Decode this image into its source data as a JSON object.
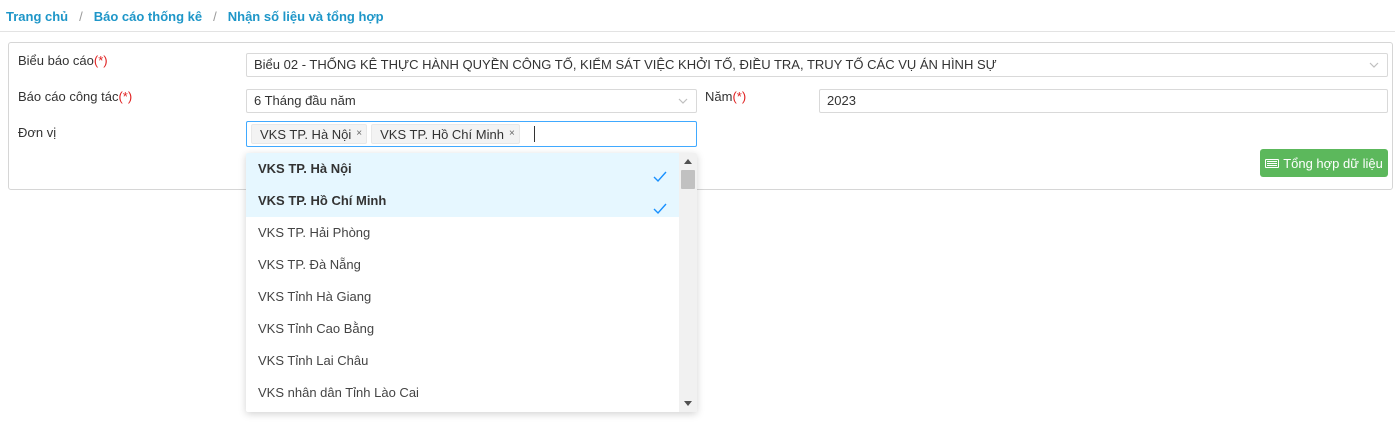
{
  "breadcrumb": {
    "items": [
      "Trang chủ",
      "Báo cáo thống kê",
      "Nhận số liệu và tổng hợp"
    ],
    "separator": "/"
  },
  "form": {
    "report_form": {
      "label": "Biểu báo cáo",
      "required_mark": "(*)",
      "value": "Biểu 02 - THỐNG KÊ THỰC HÀNH QUYỀN CÔNG TỐ, KIỂM SÁT VIỆC KHỞI TỐ, ĐIỀU TRA, TRUY TỐ CÁC VỤ ÁN HÌNH SỰ"
    },
    "work_report": {
      "label": "Báo cáo công tác",
      "required_mark": "(*)",
      "value": "6 Tháng đầu năm"
    },
    "year": {
      "label": "Năm",
      "required_mark": "(*)",
      "value": "2023"
    },
    "unit": {
      "label": "Đơn vị",
      "selected_tags": [
        "VKS TP. Hà Nội",
        "VKS TP. Hồ Chí Minh"
      ],
      "remove_glyph": "×"
    },
    "submit_label": "Tổng hợp dữ liệu"
  },
  "dropdown": {
    "options": [
      {
        "label": "VKS TP. Hà Nội",
        "selected": true
      },
      {
        "label": "VKS TP. Hồ Chí Minh",
        "selected": true
      },
      {
        "label": "VKS TP. Hải Phòng",
        "selected": false
      },
      {
        "label": "VKS TP. Đà Nẵng",
        "selected": false
      },
      {
        "label": "VKS Tỉnh Hà Giang",
        "selected": false
      },
      {
        "label": "VKS Tỉnh Cao Bằng",
        "selected": false
      },
      {
        "label": "VKS Tỉnh Lai Châu",
        "selected": false
      },
      {
        "label": "VKS nhân dân Tỉnh Lào Cai",
        "selected": false
      }
    ]
  },
  "colors": {
    "link": "#1e96c8",
    "required": "#e02020",
    "button": "#5cb85c",
    "selected_bg": "#e6f7ff",
    "check": "#1890ff"
  }
}
